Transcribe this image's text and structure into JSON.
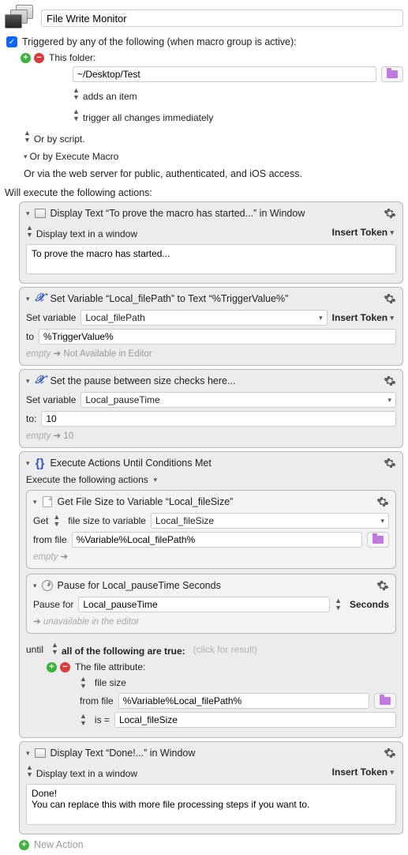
{
  "title": "File Write Monitor",
  "trigger_label": "Triggered by any of the following (when macro group is active):",
  "folder_label": "This folder:",
  "folder_path": "~/Desktop/Test",
  "adds_item": "adds an item",
  "trigger_changes": "trigger all changes immediately",
  "or_script": "Or by script.",
  "or_exec": "Or by Execute Macro",
  "via_web": "Or via the web server for public, authenticated, and iOS access.",
  "exec_label": "Will execute the following actions:",
  "insert_token": "Insert Token",
  "a1": {
    "title": "Display Text “To prove the macro has started...” in Window",
    "sub": "Display text in a window",
    "text": "To prove the macro has started..."
  },
  "a2": {
    "title": "Set Variable “Local_filePath” to Text “%TriggerValue%”",
    "setvar": "Set variable",
    "varname": "Local_filePath",
    "to": "to",
    "val": "%TriggerValue%",
    "empty": "empty",
    "na": "Not Available in Editor"
  },
  "a3": {
    "title": "Set the pause between size checks here...",
    "setvar": "Set variable",
    "varname": "Local_pauseTime",
    "to": "to:",
    "val": "10",
    "empty": "empty",
    "res": "10"
  },
  "a4": {
    "title": "Execute Actions Until Conditions Met",
    "sub": "Execute the following actions",
    "n1": {
      "title": "Get File Size to Variable “Local_fileSize”",
      "get": "Get",
      "fsize": "file size to variable",
      "var": "Local_fileSize",
      "from": "from file",
      "path": "%Variable%Local_filePath%",
      "empty": "empty"
    },
    "n2": {
      "title": "Pause for Local_pauseTime Seconds",
      "pause": "Pause for",
      "val": "Local_pauseTime",
      "sec": "Seconds",
      "unav": "unavailable in the editor"
    },
    "until": "until",
    "all_true": "all of the following are true:",
    "click": "(click for result)",
    "cond": {
      "fattr": "The file attribute:",
      "fsize": "file size",
      "from": "from file",
      "path": "%Variable%Local_filePath%",
      "is": "is =",
      "val": "Local_fileSize"
    }
  },
  "a5": {
    "title": "Display Text “Done!...” in Window",
    "sub": "Display text in a window",
    "text": "Done!\nYou can replace this with more file processing steps if you want to."
  },
  "new_action": "New Action"
}
